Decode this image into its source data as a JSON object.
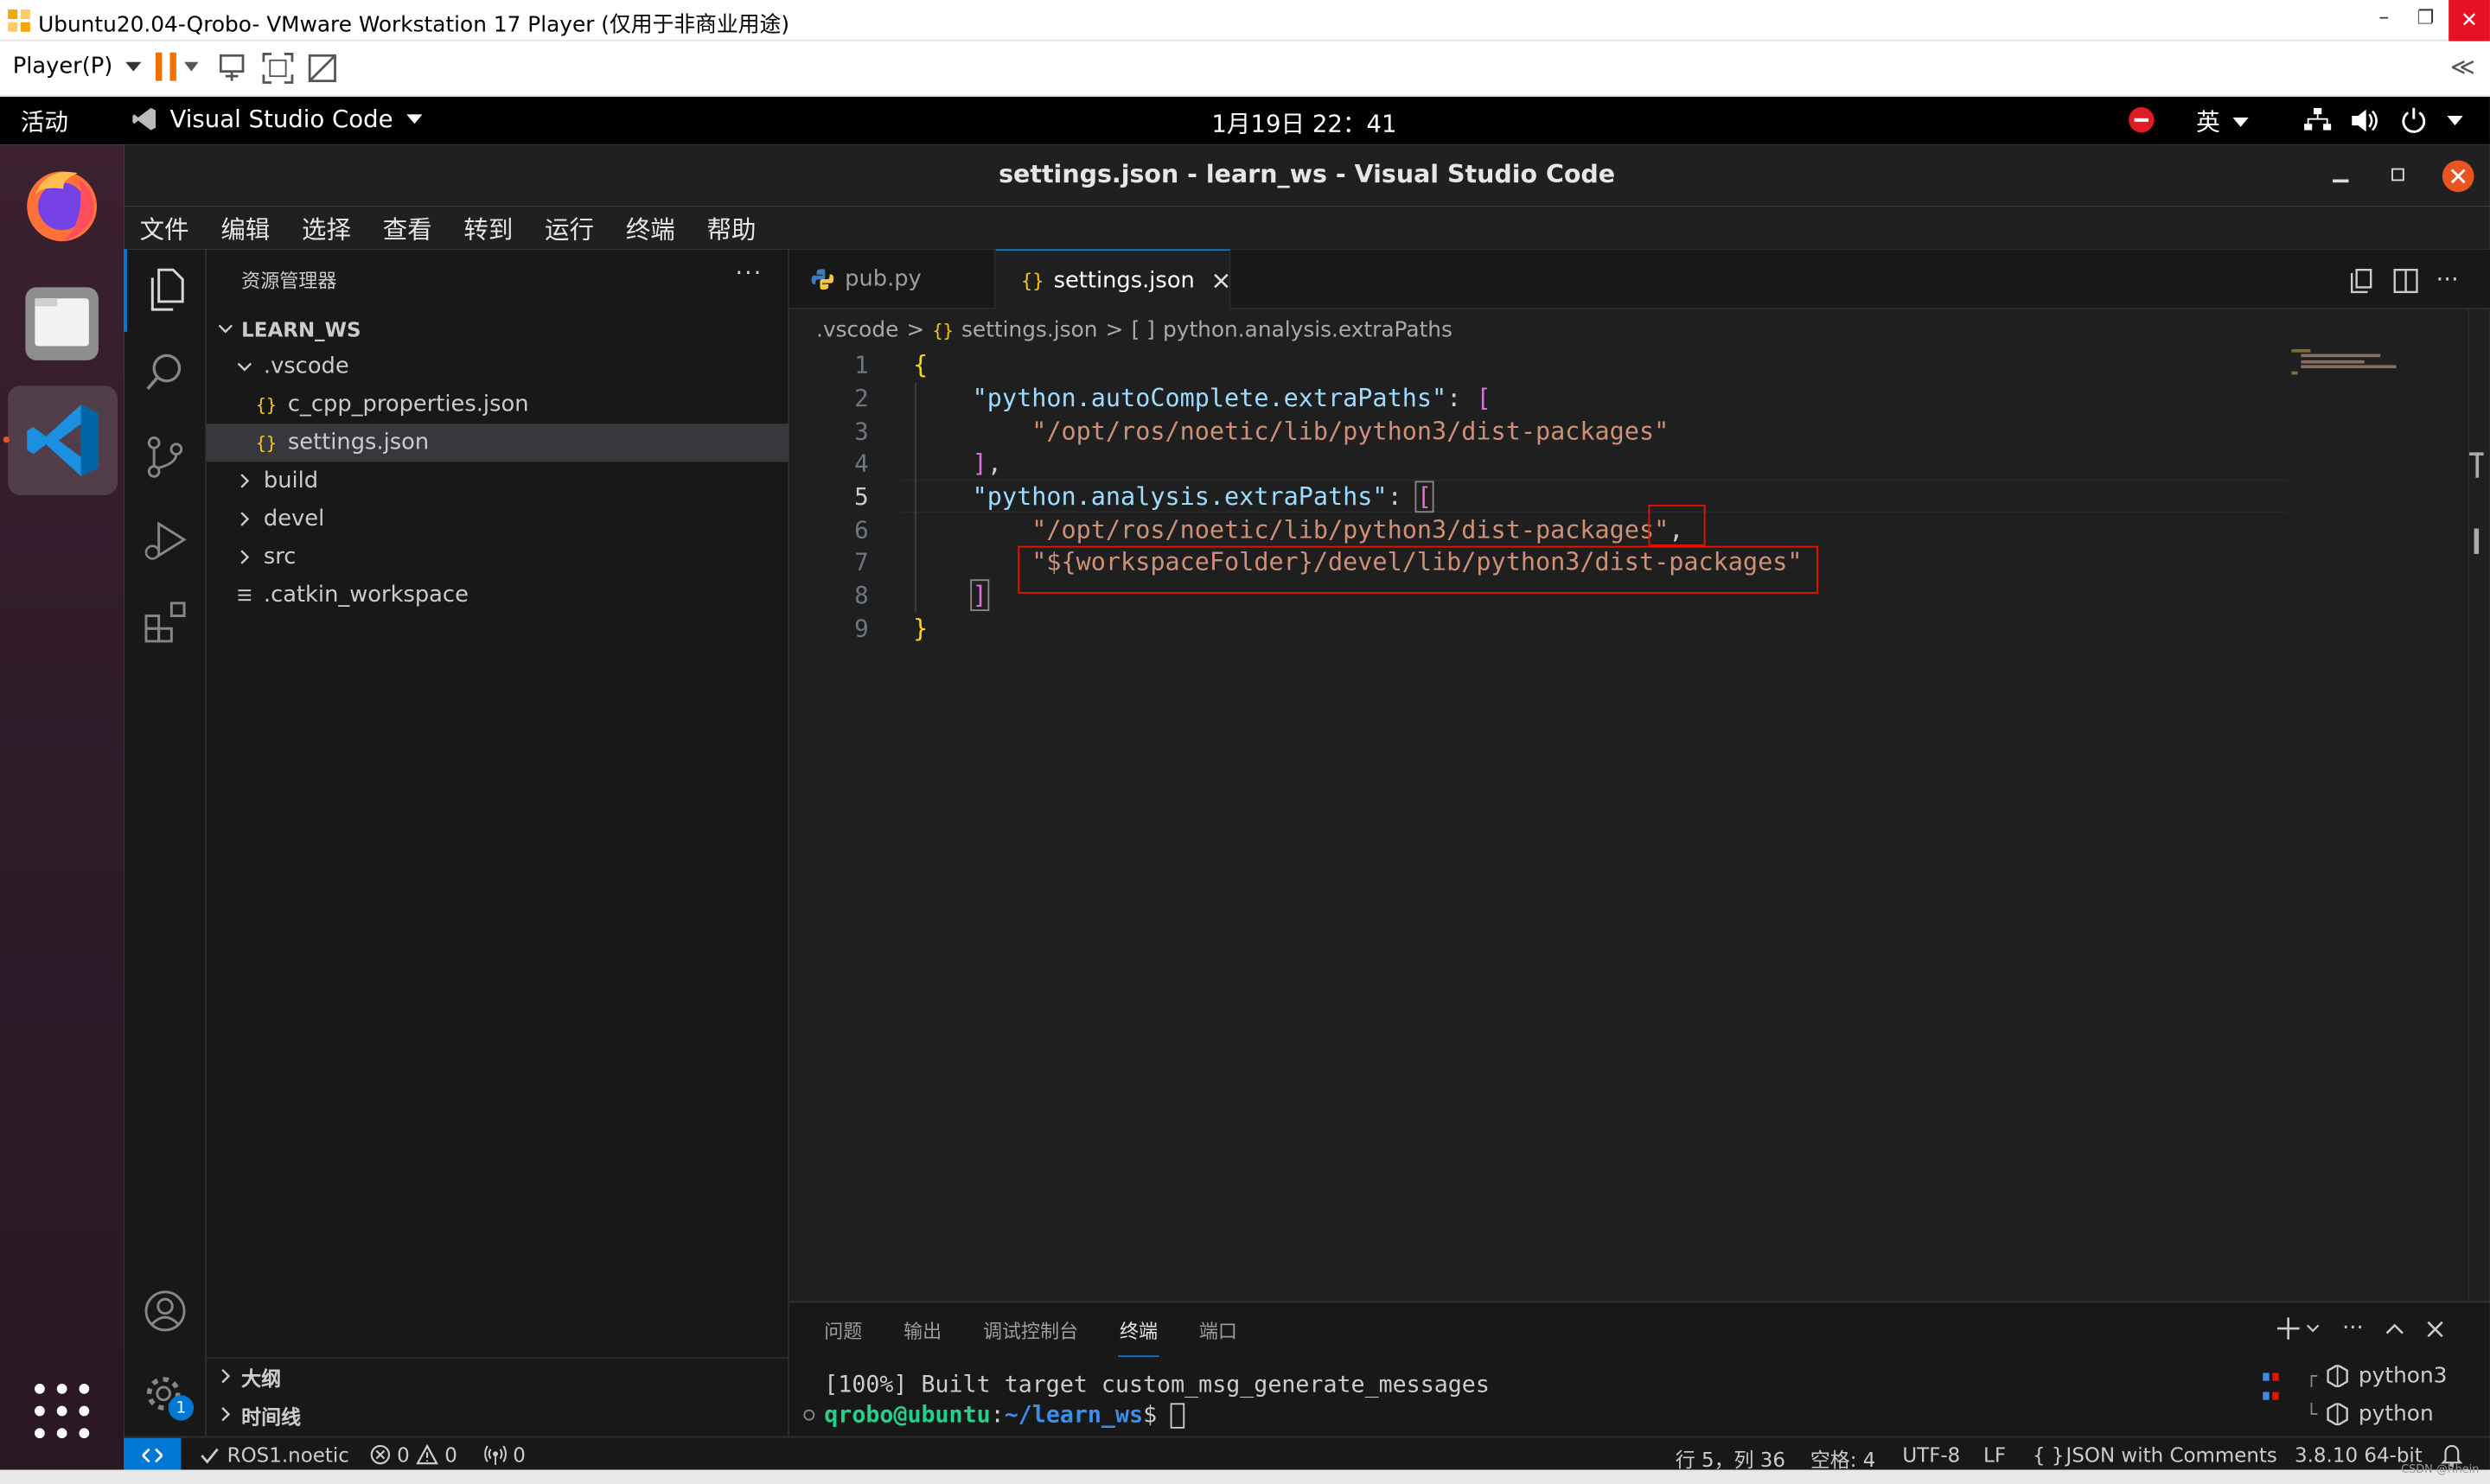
{
  "vmware": {
    "title": "Ubuntu20.04-Qrobo- VMware Workstation 17 Player (仅用于非商业用途)",
    "player_menu": "Player(P)",
    "collapse_glyph": "≪",
    "min_glyph": "–",
    "restore_glyph": "❐",
    "close_glyph": "✕"
  },
  "ubuntu": {
    "activities": "活动",
    "app_name": "Visual Studio Code",
    "clock": "1月19日  22：41",
    "input_method": "英"
  },
  "vscode": {
    "window_title": "settings.json - learn_ws - Visual Studio Code",
    "menu": [
      "文件",
      "编辑",
      "选择",
      "查看",
      "转到",
      "运行",
      "终端",
      "帮助"
    ],
    "explorer": {
      "header": "资源管理器",
      "root": "LEARN_WS",
      "items": [
        {
          "label": ".vscode",
          "kind": "folder-open",
          "indent": 1
        },
        {
          "label": "c_cpp_properties.json",
          "kind": "json",
          "indent": 2
        },
        {
          "label": "settings.json",
          "kind": "json",
          "indent": 2
        },
        {
          "label": "build",
          "kind": "folder",
          "indent": 1
        },
        {
          "label": "devel",
          "kind": "folder",
          "indent": 1
        },
        {
          "label": "src",
          "kind": "folder",
          "indent": 1
        },
        {
          "label": ".catkin_workspace",
          "kind": "file",
          "indent": 1
        }
      ],
      "outline": "大纲",
      "timeline": "时间线"
    },
    "tabs": [
      {
        "label": "pub.py",
        "active": false,
        "icon": "python-icon"
      },
      {
        "label": "settings.json",
        "active": true,
        "icon": "json-icon"
      }
    ],
    "breadcrumb": [
      ".vscode",
      "settings.json",
      "python.analysis.extraPaths"
    ],
    "breadcrumb_glyphs": {
      "sep": ">",
      "json": "{}",
      "array": "[ ]"
    },
    "line_numbers": [
      "1",
      "2",
      "3",
      "4",
      "5",
      "6",
      "7",
      "8",
      "9"
    ],
    "code": {
      "l1": "{",
      "l2_key": "\"python.autoComplete.extraPaths\"",
      "l2_colon": ": ",
      "l2_br": "[",
      "l3": "\"/opt/ros/noetic/lib/python3/dist-packages\"",
      "l4_br": "]",
      "l4_comma": ",",
      "l5_key": "\"python.analysis.extraPaths\"",
      "l5_colon": ": ",
      "l5_br": "[",
      "l6": "\"/opt/ros/noetic/lib/python3/dist-packages\"",
      "l6_comma": ",",
      "l7": "\"${workspaceFolder}/devel/lib/python3/dist-packages\"",
      "l8_br": "]",
      "l9": "}"
    },
    "panel": {
      "tabs": [
        "问题",
        "输出",
        "调试控制台",
        "终端",
        "端口"
      ],
      "active_tab": "终端",
      "terminal_line1": "[100%] Built target custom_msg_generate_messages",
      "prompt_user": "qrobo@ubuntu",
      "prompt_colon": ":",
      "prompt_path": "~/learn_ws",
      "prompt_dollar": "$ ",
      "terminals": [
        "python3",
        "python"
      ]
    },
    "status": {
      "branch": "ROS1.noetic",
      "errors": "0",
      "warnings": "0",
      "ports": "0",
      "position": "行 5，列 36",
      "spaces": "空格: 4",
      "encoding": "UTF-8",
      "eol": "LF",
      "braces": "{ }",
      "language": "JSON with Comments",
      "interpreter": "3.8.10 64-bit"
    },
    "settings_badge": "1"
  },
  "watermark": "CSDN @Rhein",
  "colors": {
    "accent": "#0078d4",
    "annotation_red": "#e51400",
    "string": "#ce9178",
    "key": "#9cdcfe",
    "bracket_gold": "#ffd700",
    "bracket_purple": "#da70d6",
    "prompt_green": "#23d18b",
    "prompt_blue": "#3b8eea"
  }
}
